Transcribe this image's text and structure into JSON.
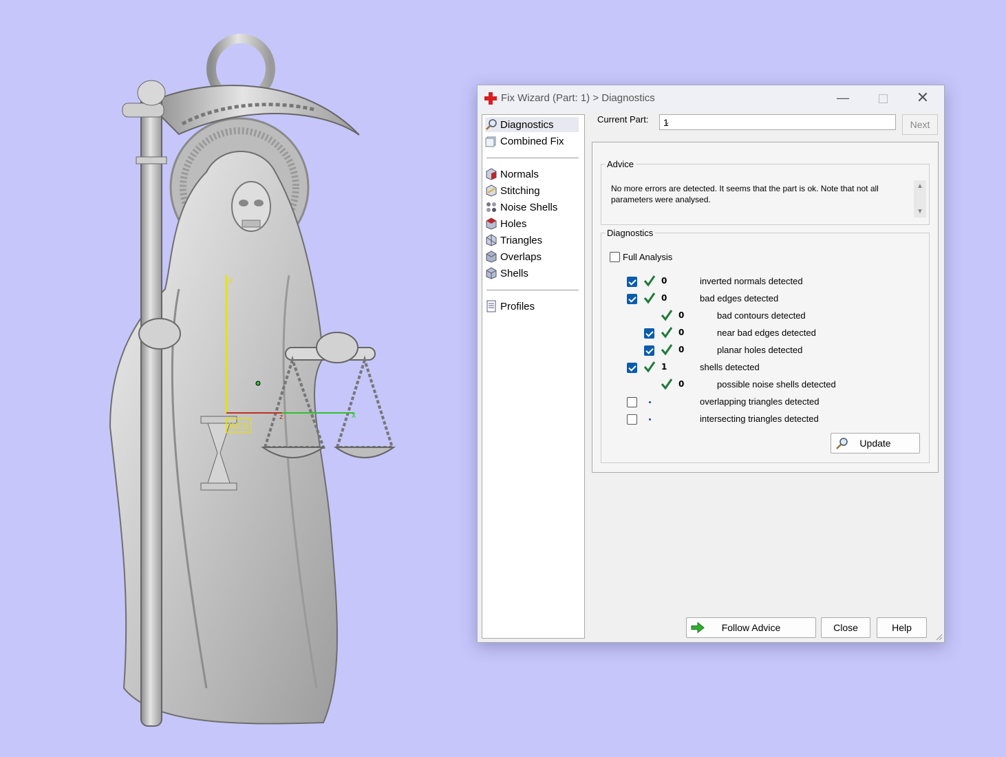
{
  "dialog": {
    "title": "Fix Wizard (Part: 1) > Diagnostics",
    "window_buttons": [
      "minimize",
      "maximize",
      "close"
    ]
  },
  "nav": {
    "group1": [
      {
        "label": "Diagnostics",
        "icon": "magnifier-icon",
        "selected": true
      },
      {
        "label": "Combined Fix",
        "icon": "combined-fix-icon"
      }
    ],
    "group2": [
      {
        "label": "Normals",
        "icon": "normals-icon"
      },
      {
        "label": "Stitching",
        "icon": "stitching-icon"
      },
      {
        "label": "Noise Shells",
        "icon": "noise-shells-icon"
      },
      {
        "label": "Holes",
        "icon": "holes-icon"
      },
      {
        "label": "Triangles",
        "icon": "triangles-icon"
      },
      {
        "label": "Overlaps",
        "icon": "overlaps-icon"
      },
      {
        "label": "Shells",
        "icon": "shells-icon"
      }
    ],
    "group3": [
      {
        "label": "Profiles",
        "icon": "profiles-icon"
      }
    ]
  },
  "current_part": {
    "label": "Current Part:",
    "value": "1",
    "next_label": "Next"
  },
  "advice": {
    "legend": "Advice",
    "text": "No more errors are detected. It seems that the part is ok. Note that not all parameters were analysed."
  },
  "diagnostics": {
    "legend": "Diagnostics",
    "full_analysis_label": "Full Analysis",
    "full_analysis_checked": false,
    "rows": [
      {
        "checkbox": true,
        "status": "ok",
        "count": "0",
        "label": "inverted normals detected",
        "indent": 0
      },
      {
        "checkbox": true,
        "status": "ok",
        "count": "0",
        "label": "bad edges detected",
        "indent": 0
      },
      {
        "checkbox": null,
        "status": "ok",
        "count": "0",
        "label": "bad contours detected",
        "indent": 1
      },
      {
        "checkbox": true,
        "status": "ok",
        "count": "0",
        "label": "near bad edges detected",
        "indent": 1
      },
      {
        "checkbox": true,
        "status": "ok",
        "count": "0",
        "label": "planar holes detected",
        "indent": 1
      },
      {
        "checkbox": true,
        "status": "ok",
        "count": "1",
        "label": "shells detected",
        "indent": 0
      },
      {
        "checkbox": null,
        "status": "ok",
        "count": "0",
        "label": "possible noise shells detected",
        "indent": 1
      },
      {
        "checkbox": false,
        "status": "pending",
        "count": "",
        "label": "overlapping triangles detected",
        "indent": 0
      },
      {
        "checkbox": false,
        "status": "pending",
        "count": "",
        "label": "intersecting triangles detected",
        "indent": 0
      }
    ],
    "update_label": "Update"
  },
  "footer": {
    "follow_advice_label": "Follow Advice",
    "close_label": "Close",
    "help_label": "Help"
  },
  "viewport": {
    "background": "#c6c6fb",
    "axis_labels": {
      "x": "x",
      "y": "y",
      "z": "z",
      "origin": "WCS"
    }
  },
  "colors": {
    "accent": "#0b5cad",
    "ok_tick": "#1e7a3a",
    "title_icon": "#d81e1e",
    "arrow": "#2fae2f"
  }
}
